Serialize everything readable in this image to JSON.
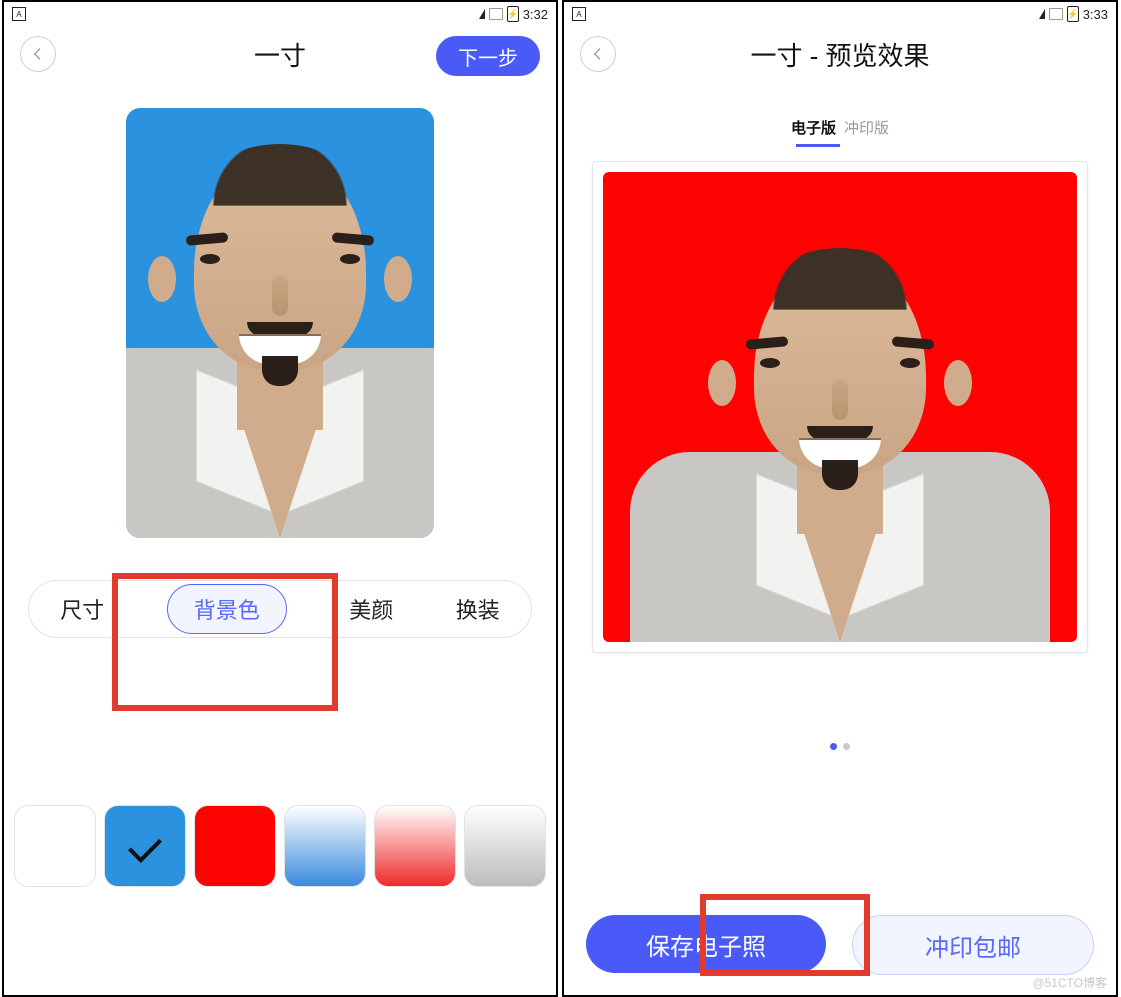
{
  "left": {
    "statusbar": {
      "badge": "A",
      "time": "3:32"
    },
    "nav": {
      "title": "一寸",
      "next": "下一步"
    },
    "tabs": {
      "size": "尺寸",
      "bgcolor": "背景色",
      "beauty": "美颜",
      "dress": "换装",
      "active": "bgcolor"
    },
    "swatches": {
      "items": [
        "white",
        "blue",
        "red",
        "blue-gradient",
        "red-gradient",
        "grey-gradient"
      ],
      "selected": "blue"
    },
    "photo_bg": "#2a92df"
  },
  "right": {
    "statusbar": {
      "badge": "A",
      "time": "3:33"
    },
    "nav": {
      "title": "一寸 - 预览效果"
    },
    "subtabs": {
      "digital": "电子版",
      "print": "冲印版",
      "active": "digital"
    },
    "photo_bg": "#ff0302",
    "cta": {
      "primary": "保存电子照",
      "secondary": "冲印包邮"
    }
  },
  "watermark": "@51CTO博客"
}
